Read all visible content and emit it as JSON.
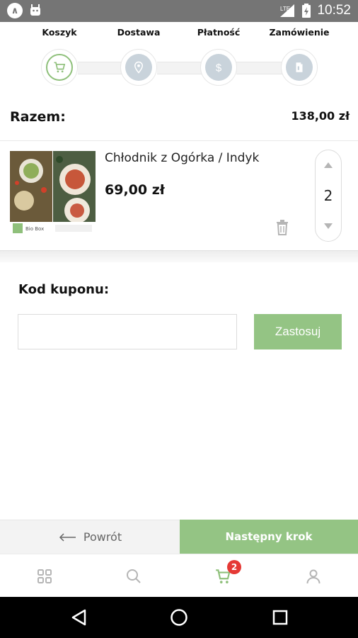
{
  "status_bar": {
    "time": "10:52",
    "network": "LTE",
    "icons": [
      "app-circle-icon",
      "android-icon",
      "signal-icon",
      "battery-icon"
    ]
  },
  "steps": [
    {
      "label": "Koszyk",
      "icon": "cart-icon",
      "active": true
    },
    {
      "label": "Dostawa",
      "icon": "location-pin-icon",
      "active": false
    },
    {
      "label": "Płatność",
      "icon": "dollar-icon",
      "active": false
    },
    {
      "label": "Zamówienie",
      "icon": "document-icon",
      "active": false
    }
  ],
  "total": {
    "label": "Razem:",
    "value": "138,00 zł"
  },
  "cart_item": {
    "name": "Chłodnik z Ogórka / Indyk",
    "price": "69,00 zł",
    "quantity": "2",
    "image_caption": "Bio Box"
  },
  "coupon": {
    "label": "Kod kuponu:",
    "value": "",
    "placeholder": "",
    "apply_label": "Zastosuj"
  },
  "actions": {
    "back_label": "Powrót",
    "next_label": "Następny krok"
  },
  "tabs": [
    {
      "name": "grid",
      "icon": "grid-icon"
    },
    {
      "name": "search",
      "icon": "search-icon"
    },
    {
      "name": "cart",
      "icon": "cart-icon",
      "badge": "2"
    },
    {
      "name": "profile",
      "icon": "user-icon"
    }
  ],
  "colors": {
    "accent": "#94c484",
    "step_inactive": "#c9d3db",
    "badge": "#e53935"
  }
}
